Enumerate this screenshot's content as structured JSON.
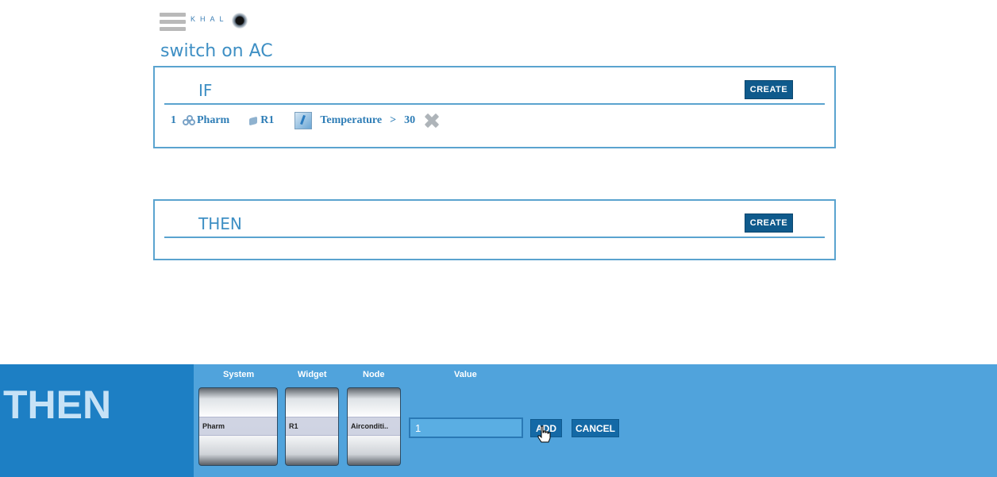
{
  "header": {
    "brand": "KHAL",
    "rule_name": "switch on AC"
  },
  "if_panel": {
    "title": "IF",
    "create_label": "CREATE",
    "conditions": [
      {
        "index": "1",
        "system": "Pharm",
        "widget": "R1",
        "node": "Temperature",
        "operator": ">",
        "value": "30"
      }
    ]
  },
  "then_panel": {
    "title": "THEN",
    "create_label": "CREATE"
  },
  "editor": {
    "side_title": "THEN",
    "labels": {
      "system": "System",
      "widget": "Widget",
      "node": "Node",
      "value": "Value"
    },
    "selected": {
      "system": "Pharm",
      "widget": "R1",
      "node": "Airconditi.."
    },
    "value_input": "1",
    "add_label": "ADD",
    "cancel_label": "CANCEL"
  },
  "colors": {
    "accent": "#3e8fc4",
    "button": "#0f5a8c",
    "editor_bg": "#50a3dc",
    "editor_side": "#1d7fc4"
  }
}
